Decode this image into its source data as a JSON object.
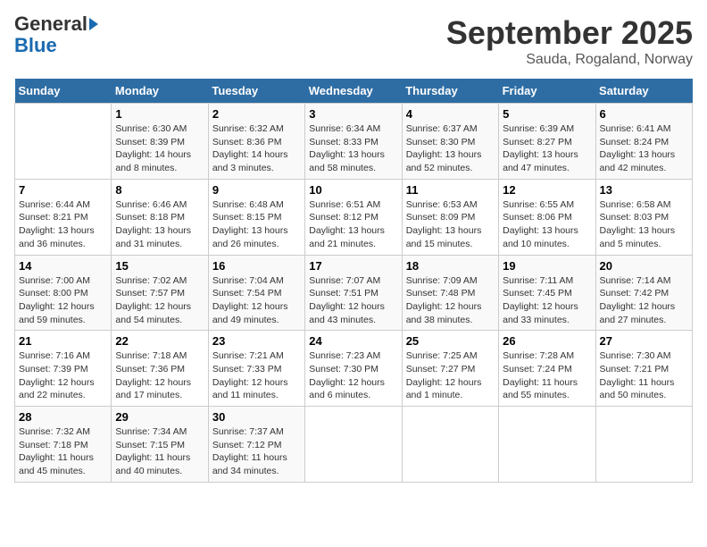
{
  "logo": {
    "top": "General",
    "bottom": "Blue",
    "arrow": true
  },
  "title": "September 2025",
  "subtitle": "Sauda, Rogaland, Norway",
  "weekdays": [
    "Sunday",
    "Monday",
    "Tuesday",
    "Wednesday",
    "Thursday",
    "Friday",
    "Saturday"
  ],
  "weeks": [
    [
      {
        "day": "",
        "info": ""
      },
      {
        "day": "1",
        "info": "Sunrise: 6:30 AM\nSunset: 8:39 PM\nDaylight: 14 hours\nand 8 minutes."
      },
      {
        "day": "2",
        "info": "Sunrise: 6:32 AM\nSunset: 8:36 PM\nDaylight: 14 hours\nand 3 minutes."
      },
      {
        "day": "3",
        "info": "Sunrise: 6:34 AM\nSunset: 8:33 PM\nDaylight: 13 hours\nand 58 minutes."
      },
      {
        "day": "4",
        "info": "Sunrise: 6:37 AM\nSunset: 8:30 PM\nDaylight: 13 hours\nand 52 minutes."
      },
      {
        "day": "5",
        "info": "Sunrise: 6:39 AM\nSunset: 8:27 PM\nDaylight: 13 hours\nand 47 minutes."
      },
      {
        "day": "6",
        "info": "Sunrise: 6:41 AM\nSunset: 8:24 PM\nDaylight: 13 hours\nand 42 minutes."
      }
    ],
    [
      {
        "day": "7",
        "info": "Sunrise: 6:44 AM\nSunset: 8:21 PM\nDaylight: 13 hours\nand 36 minutes."
      },
      {
        "day": "8",
        "info": "Sunrise: 6:46 AM\nSunset: 8:18 PM\nDaylight: 13 hours\nand 31 minutes."
      },
      {
        "day": "9",
        "info": "Sunrise: 6:48 AM\nSunset: 8:15 PM\nDaylight: 13 hours\nand 26 minutes."
      },
      {
        "day": "10",
        "info": "Sunrise: 6:51 AM\nSunset: 8:12 PM\nDaylight: 13 hours\nand 21 minutes."
      },
      {
        "day": "11",
        "info": "Sunrise: 6:53 AM\nSunset: 8:09 PM\nDaylight: 13 hours\nand 15 minutes."
      },
      {
        "day": "12",
        "info": "Sunrise: 6:55 AM\nSunset: 8:06 PM\nDaylight: 13 hours\nand 10 minutes."
      },
      {
        "day": "13",
        "info": "Sunrise: 6:58 AM\nSunset: 8:03 PM\nDaylight: 13 hours\nand 5 minutes."
      }
    ],
    [
      {
        "day": "14",
        "info": "Sunrise: 7:00 AM\nSunset: 8:00 PM\nDaylight: 12 hours\nand 59 minutes."
      },
      {
        "day": "15",
        "info": "Sunrise: 7:02 AM\nSunset: 7:57 PM\nDaylight: 12 hours\nand 54 minutes."
      },
      {
        "day": "16",
        "info": "Sunrise: 7:04 AM\nSunset: 7:54 PM\nDaylight: 12 hours\nand 49 minutes."
      },
      {
        "day": "17",
        "info": "Sunrise: 7:07 AM\nSunset: 7:51 PM\nDaylight: 12 hours\nand 43 minutes."
      },
      {
        "day": "18",
        "info": "Sunrise: 7:09 AM\nSunset: 7:48 PM\nDaylight: 12 hours\nand 38 minutes."
      },
      {
        "day": "19",
        "info": "Sunrise: 7:11 AM\nSunset: 7:45 PM\nDaylight: 12 hours\nand 33 minutes."
      },
      {
        "day": "20",
        "info": "Sunrise: 7:14 AM\nSunset: 7:42 PM\nDaylight: 12 hours\nand 27 minutes."
      }
    ],
    [
      {
        "day": "21",
        "info": "Sunrise: 7:16 AM\nSunset: 7:39 PM\nDaylight: 12 hours\nand 22 minutes."
      },
      {
        "day": "22",
        "info": "Sunrise: 7:18 AM\nSunset: 7:36 PM\nDaylight: 12 hours\nand 17 minutes."
      },
      {
        "day": "23",
        "info": "Sunrise: 7:21 AM\nSunset: 7:33 PM\nDaylight: 12 hours\nand 11 minutes."
      },
      {
        "day": "24",
        "info": "Sunrise: 7:23 AM\nSunset: 7:30 PM\nDaylight: 12 hours\nand 6 minutes."
      },
      {
        "day": "25",
        "info": "Sunrise: 7:25 AM\nSunset: 7:27 PM\nDaylight: 12 hours\nand 1 minute."
      },
      {
        "day": "26",
        "info": "Sunrise: 7:28 AM\nSunset: 7:24 PM\nDaylight: 11 hours\nand 55 minutes."
      },
      {
        "day": "27",
        "info": "Sunrise: 7:30 AM\nSunset: 7:21 PM\nDaylight: 11 hours\nand 50 minutes."
      }
    ],
    [
      {
        "day": "28",
        "info": "Sunrise: 7:32 AM\nSunset: 7:18 PM\nDaylight: 11 hours\nand 45 minutes."
      },
      {
        "day": "29",
        "info": "Sunrise: 7:34 AM\nSunset: 7:15 PM\nDaylight: 11 hours\nand 40 minutes."
      },
      {
        "day": "30",
        "info": "Sunrise: 7:37 AM\nSunset: 7:12 PM\nDaylight: 11 hours\nand 34 minutes."
      },
      {
        "day": "",
        "info": ""
      },
      {
        "day": "",
        "info": ""
      },
      {
        "day": "",
        "info": ""
      },
      {
        "day": "",
        "info": ""
      }
    ]
  ]
}
